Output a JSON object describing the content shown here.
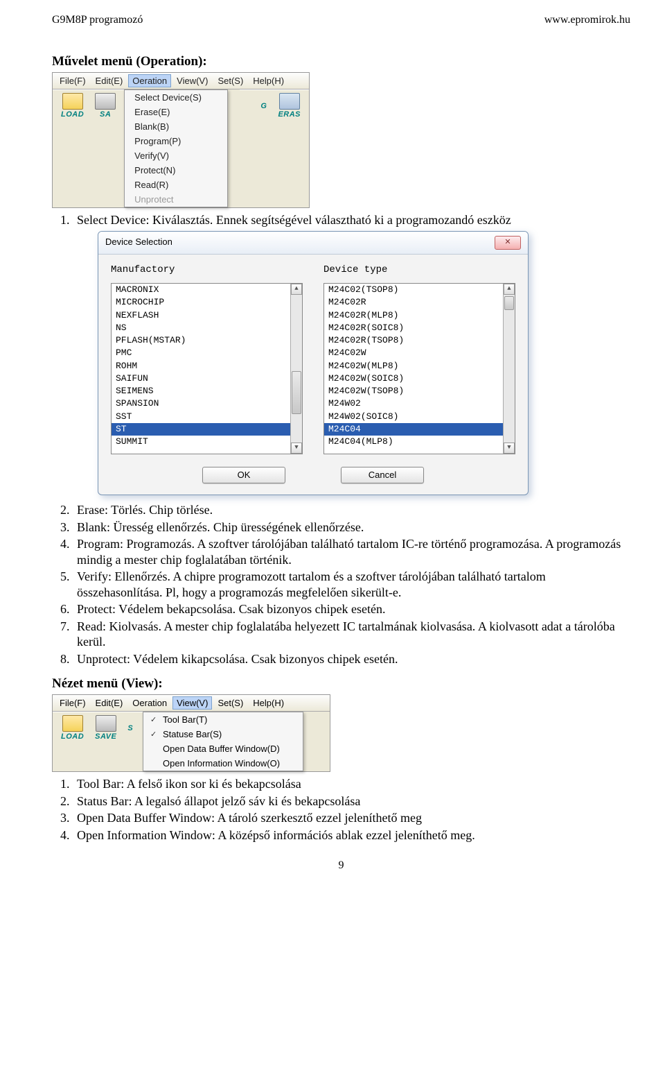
{
  "header": {
    "left": "G9M8P programozó",
    "right": "www.epromirok.hu"
  },
  "sec_operation_title": "Művelet menü (Operation):",
  "op_menubar": [
    "File(F)",
    "Edit(E)",
    "Oeration",
    "View(V)",
    "Set(S)",
    "Help(H)"
  ],
  "op_menubar_active_index": 2,
  "op_dropdown": [
    {
      "label": "Select Device(S)",
      "disabled": false
    },
    {
      "label": "Erase(E)",
      "disabled": false
    },
    {
      "label": "Blank(B)",
      "disabled": false
    },
    {
      "label": "Program(P)",
      "disabled": false
    },
    {
      "label": "Verify(V)",
      "disabled": false
    },
    {
      "label": "Protect(N)",
      "disabled": false
    },
    {
      "label": "Read(R)",
      "disabled": false
    },
    {
      "label": "Unprotect",
      "disabled": true
    }
  ],
  "toolbar": {
    "load": "LOAD",
    "save": "SA",
    "g": "G",
    "eras": "ERAS"
  },
  "op_intro": "Select Device: Kiválasztás. Ennek segítségével választható ki a programozandó eszköz",
  "dialog": {
    "title": "Device Selection",
    "close": "✕",
    "col1_label": "Manufactory",
    "col2_label": "Device type",
    "manufacturers": [
      "MACRONIX",
      "MICROCHIP",
      "NEXFLASH",
      "NS",
      "PFLASH(MSTAR)",
      "PMC",
      "ROHM",
      "SAIFUN",
      "SEIMENS",
      "SPANSION",
      "SST",
      "ST",
      "SUMMIT"
    ],
    "manufacturers_selected_index": 11,
    "devices": [
      "M24C02(TSOP8)",
      "M24C02R",
      "M24C02R(MLP8)",
      "M24C02R(SOIC8)",
      "M24C02R(TSOP8)",
      "M24C02W",
      "M24C02W(MLP8)",
      "M24C02W(SOIC8)",
      "M24C02W(TSOP8)",
      "M24W02",
      "M24W02(SOIC8)",
      "M24C04",
      "M24C04(MLP8)"
    ],
    "devices_selected_index": 11,
    "ok_label": "OK",
    "cancel_label": "Cancel"
  },
  "op_list": [
    "Erase: Törlés. Chip törlése.",
    "Blank: Üresség ellenőrzés. Chip ürességének ellenőrzése.",
    "Program: Programozás. A szoftver tárolójában található tartalom IC-re történő programozása. A programozás mindig a mester chip foglalatában történik.",
    "Verify: Ellenőrzés. A chipre programozott tartalom és a szoftver tárolójában található tartalom összehasonlítása. Pl, hogy a programozás megfelelően sikerült-e.",
    "Protect: Védelem bekapcsolása. Csak bizonyos chipek esetén.",
    "Read: Kiolvasás. A mester chip foglalatába helyezett IC tartalmának kiolvasása. A kiolvasott adat a tárolóba kerül.",
    "Unprotect: Védelem kikapcsolása. Csak bizonyos chipek esetén."
  ],
  "sec_view_title": "Nézet menü (View):",
  "view_menubar": [
    "File(F)",
    "Edit(E)",
    "Oeration",
    "View(V)",
    "Set(S)",
    "Help(H)"
  ],
  "view_menubar_active_index": 3,
  "view_dropdown": [
    {
      "label": "Tool Bar(T)",
      "checked": true
    },
    {
      "label": "Statuse Bar(S)",
      "checked": true
    },
    {
      "label": "Open Data Buffer Window(D)",
      "checked": false
    },
    {
      "label": "Open Information Window(O)",
      "checked": false
    }
  ],
  "view_toolbar_partial": {
    "load": "LOAD",
    "save": "SAVE",
    "s": "S"
  },
  "view_list": [
    "Tool Bar: A felső ikon sor ki és bekapcsolása",
    "Status Bar: A legalsó állapot jelző sáv ki és bekapcsolása",
    "Open Data Buffer Window: A tároló szerkesztő ezzel jeleníthető meg",
    "Open Information Window: A középső információs ablak ezzel jeleníthető meg."
  ],
  "page_num": "9"
}
